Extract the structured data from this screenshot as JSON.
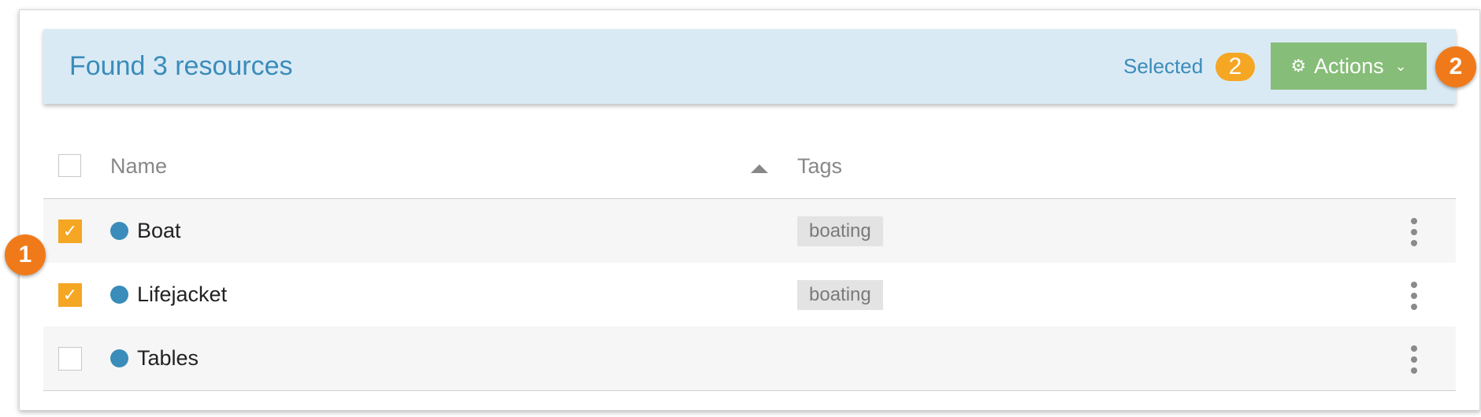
{
  "header": {
    "found_text": "Found 3 resources",
    "selected_label": "Selected",
    "selected_count": "2",
    "actions_label": "Actions"
  },
  "callouts": [
    "1",
    "2"
  ],
  "table": {
    "columns": {
      "name": "Name",
      "tags": "Tags"
    },
    "sort": {
      "column": "name",
      "direction": "ascending"
    },
    "rows": [
      {
        "name": "Boat",
        "tag": "boating",
        "checked": true
      },
      {
        "name": "Lifejacket",
        "tag": "boating",
        "checked": true
      },
      {
        "name": "Tables",
        "tag": "",
        "checked": false
      }
    ]
  },
  "icons": {
    "actions": "gear-icon",
    "dropdown": "chevron-down-icon",
    "sort": "sort-up-icon",
    "row_menu": "more-vertical-icon",
    "status": "status-dot-icon",
    "checked": "checkmark-icon"
  },
  "colors": {
    "accent": "#3a8cba",
    "header_bg": "#daeaf5",
    "selected_badge": "#f5a623",
    "actions_button": "#86bd78",
    "callout": "#f07a1a",
    "tag_bg": "#e3e3e3"
  }
}
